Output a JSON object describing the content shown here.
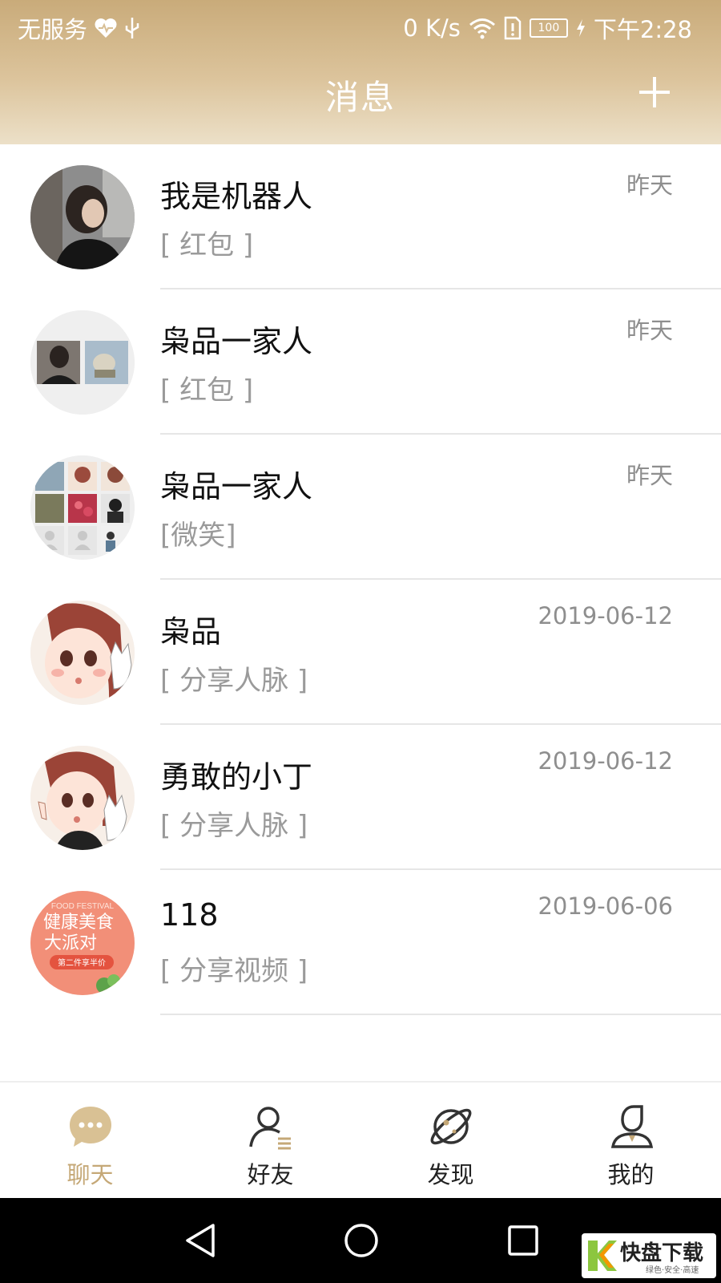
{
  "status_bar": {
    "carrier": "无服务",
    "speed": "0 K/s",
    "battery": "100",
    "time": "下午2:28"
  },
  "header": {
    "title": "消息"
  },
  "conversations": [
    {
      "name": "我是机器人",
      "preview": "[ 红包 ]",
      "time": "昨天",
      "avatar": "photo-woman"
    },
    {
      "name": "枭品一家人",
      "preview": "[ 红包 ]",
      "time": "昨天",
      "avatar": "group-2"
    },
    {
      "name": "枭品一家人",
      "preview": "[微笑]",
      "time": "昨天",
      "avatar": "group-9"
    },
    {
      "name": "枭品",
      "preview": "[ 分享人脉 ]",
      "time": "2019-06-12",
      "avatar": "cartoon-girl"
    },
    {
      "name": "勇敢的小丁",
      "preview": "[ 分享人脉 ]",
      "time": "2019-06-12",
      "avatar": "cartoon-girl-peace"
    },
    {
      "name": "118",
      "preview": "[ 分享视频 ]",
      "time": "2019-06-06",
      "avatar": "food-festival"
    }
  ],
  "food_avatar": {
    "line1": "FOOD FESTIVAL",
    "line2": "健康美食",
    "line3": "大派对",
    "line4": "第二件享半价"
  },
  "tabs": [
    {
      "label": "聊天",
      "icon": "chat-bubble-icon",
      "active": true
    },
    {
      "label": "好友",
      "icon": "friends-icon",
      "active": false
    },
    {
      "label": "发现",
      "icon": "planet-icon",
      "active": false
    },
    {
      "label": "我的",
      "icon": "profile-icon",
      "active": false
    }
  ],
  "watermark": {
    "brand": "快盘下载",
    "slogan": "绿色·安全·高速"
  },
  "colors": {
    "accent": "#c5a877",
    "header_top": "#c9ab7a",
    "header_bottom": "#ece0c8"
  }
}
